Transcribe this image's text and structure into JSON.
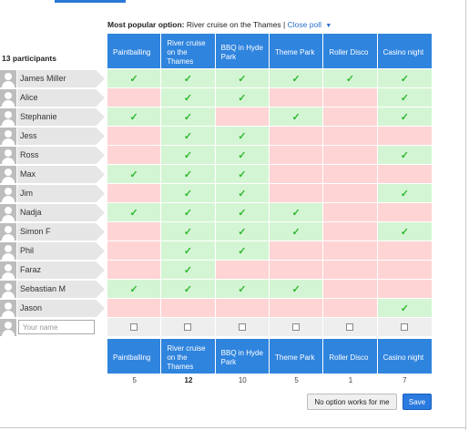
{
  "popular": {
    "label": "Most popular option:",
    "value": "River cruise on the Thames",
    "separator": "|",
    "close_link": "Close poll",
    "caret": "▼"
  },
  "participants_label": "13 participants",
  "options": [
    "Paintballing",
    "River cruise on the Thames",
    "BBQ in Hyde Park",
    "Theme Park",
    "Roller Disco",
    "Casino night"
  ],
  "check_glyph": "✓",
  "participants": [
    {
      "name": "James Miller",
      "votes": [
        1,
        1,
        1,
        1,
        1,
        1
      ]
    },
    {
      "name": "Alice",
      "votes": [
        0,
        1,
        1,
        0,
        0,
        1
      ]
    },
    {
      "name": "Stephanie",
      "votes": [
        1,
        1,
        0,
        1,
        0,
        1
      ]
    },
    {
      "name": "Jess",
      "votes": [
        0,
        1,
        1,
        0,
        0,
        0
      ]
    },
    {
      "name": "Ross",
      "votes": [
        0,
        1,
        1,
        0,
        0,
        1
      ]
    },
    {
      "name": "Max",
      "votes": [
        1,
        1,
        1,
        0,
        0,
        0
      ]
    },
    {
      "name": "Jim",
      "votes": [
        0,
        1,
        1,
        0,
        0,
        1
      ]
    },
    {
      "name": "Nadja",
      "votes": [
        1,
        1,
        1,
        1,
        0,
        0
      ]
    },
    {
      "name": "Simon F",
      "votes": [
        0,
        1,
        1,
        1,
        0,
        1
      ]
    },
    {
      "name": "Phil",
      "votes": [
        0,
        1,
        1,
        0,
        0,
        0
      ]
    },
    {
      "name": "Faraz",
      "votes": [
        0,
        1,
        0,
        0,
        0,
        0
      ]
    },
    {
      "name": "Sebastian M",
      "votes": [
        1,
        1,
        1,
        1,
        0,
        0
      ]
    },
    {
      "name": "Jason",
      "votes": [
        0,
        0,
        0,
        0,
        0,
        1
      ]
    }
  ],
  "new_row": {
    "placeholder": "Your name"
  },
  "counts": [
    5,
    12,
    10,
    5,
    1,
    7
  ],
  "buttons": {
    "no_option": "No option works for me",
    "save": "Save"
  }
}
